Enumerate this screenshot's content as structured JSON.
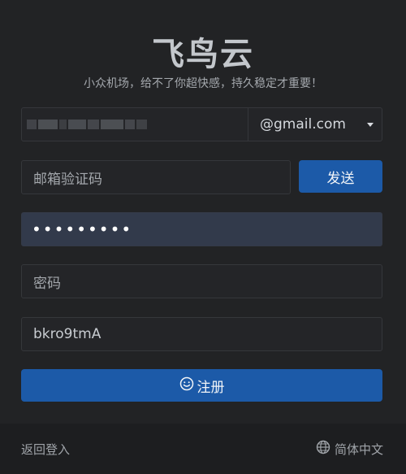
{
  "app": {
    "title": "飞鸟云",
    "subtitle": "小众机场，给不了你超快感，持久稳定才重要！"
  },
  "form": {
    "email_domain": "@gmail.com",
    "email_code_placeholder": "邮箱验证码",
    "send_label": "发送",
    "password_mask": "•••••••••",
    "confirm_password_placeholder": "密码",
    "invite_code": "bkro9tmA",
    "register_label": "注册"
  },
  "footer": {
    "back_label": "返回登入",
    "language_label": "简体中文"
  },
  "icons": {
    "register": "smile-icon",
    "language": "globe-icon",
    "dropdown": "chevron-down-icon"
  },
  "colors": {
    "background": "#222325",
    "accent": "#1c5aa8",
    "footer": "#1d1e20"
  }
}
